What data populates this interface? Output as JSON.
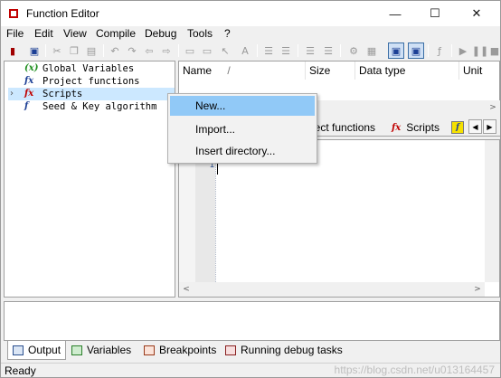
{
  "window": {
    "title": "Function Editor",
    "controls": {
      "minimize": "—",
      "maximize": "☐",
      "close": "✕"
    }
  },
  "menubar": {
    "items": [
      "File",
      "Edit",
      "View",
      "Compile",
      "Debug",
      "Tools",
      "?"
    ]
  },
  "toolbar": {
    "icons": [
      "exit-icon",
      "save-icon",
      "cut-icon",
      "copy-icon",
      "paste-icon",
      "undo-icon",
      "redo-icon",
      "import-icon",
      "export-icon",
      "window-icon",
      "windows-icon",
      "pointer-icon",
      "font-size-icon",
      "indent-icon",
      "outdent-icon",
      "comment-icon",
      "uncomment-icon",
      "compile-icon",
      "build-icon",
      "layout-one-icon",
      "layout-two-icon",
      "function-icon",
      "run-icon",
      "pause-icon",
      "stop-icon"
    ]
  },
  "tree": {
    "items": [
      {
        "icon": "(x)",
        "label": "Global Variables",
        "icon_color": "#1f8f1f",
        "expandable": false,
        "selected": false
      },
      {
        "icon": "fx",
        "label": "Project functions",
        "icon_color": "#1c3f95",
        "expandable": false,
        "selected": false
      },
      {
        "icon": "fx",
        "label": "Scripts",
        "icon_color": "#c00000",
        "expandable": true,
        "expander": "›",
        "selected": true
      },
      {
        "icon": "f",
        "label": "Seed & Key algorithm",
        "icon_color": "#1c3f95",
        "expandable": false,
        "selected": false
      }
    ]
  },
  "list": {
    "columns": [
      "Name",
      "/",
      "Size",
      "Data type",
      "Unit"
    ]
  },
  "tabs": {
    "items": [
      {
        "label": "ject functions",
        "icon": ""
      },
      {
        "label": "Scripts",
        "icon": "fx"
      }
    ],
    "nav_prev": "◀",
    "nav_next": "▶"
  },
  "editor": {
    "line_marker": "1"
  },
  "bottom_tabs": {
    "items": [
      "Output",
      "Variables",
      "Breakpoints",
      "Running debug tasks"
    ],
    "active": "Output"
  },
  "status": {
    "text": "Ready",
    "watermark": "https://blog.csdn.net/u013164457"
  },
  "context_menu": {
    "items": [
      "New...",
      "Import...",
      "Insert directory..."
    ],
    "highlighted": "New..."
  },
  "colors": {
    "selection": "#cce8ff",
    "menu_hover": "#91c9f7",
    "chrome": "#f0f0f0"
  }
}
